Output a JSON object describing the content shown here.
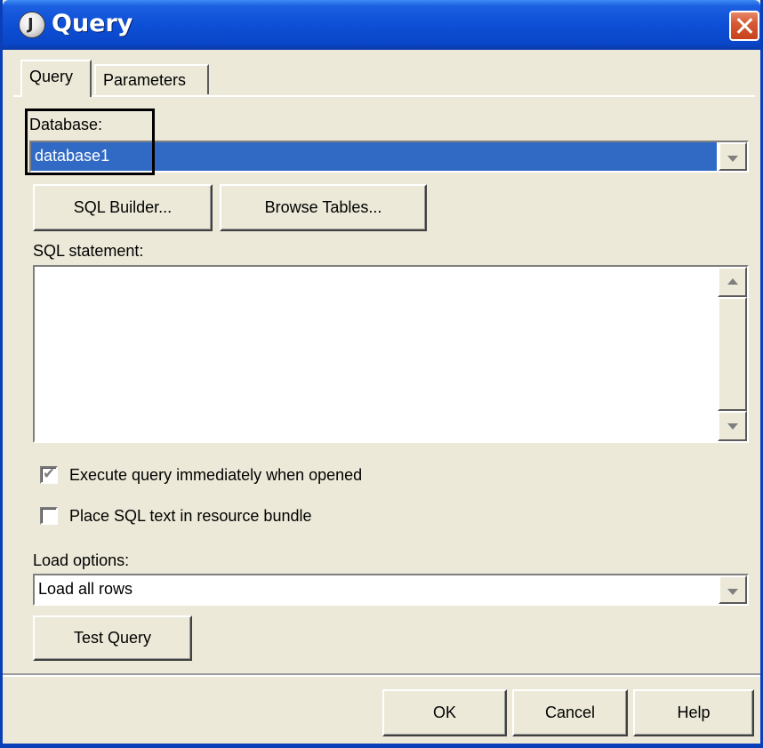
{
  "window": {
    "title": "Query",
    "title_icon": "java-cup-icon",
    "close_icon": "close-icon"
  },
  "tabs": [
    {
      "label": "Query",
      "active": true
    },
    {
      "label": "Parameters",
      "active": false
    }
  ],
  "database": {
    "label": "Database:",
    "value": "database1"
  },
  "buttons": {
    "sql_builder": "SQL Builder...",
    "browse_tables": "Browse Tables...",
    "test_query": "Test Query",
    "ok": "OK",
    "cancel": "Cancel",
    "help": "Help"
  },
  "sql": {
    "label": "SQL statement:",
    "value": ""
  },
  "options": {
    "execute_immediately": {
      "label": "Execute query immediately when opened",
      "checked": true
    },
    "resource_bundle": {
      "label": "Place SQL text in resource bundle",
      "checked": false
    }
  },
  "load_options": {
    "label": "Load options:",
    "value": "Load all rows"
  },
  "colors": {
    "title_bar": "#0a46c8",
    "selection": "#316ac5",
    "dialog_bg": "#ece9d8"
  }
}
